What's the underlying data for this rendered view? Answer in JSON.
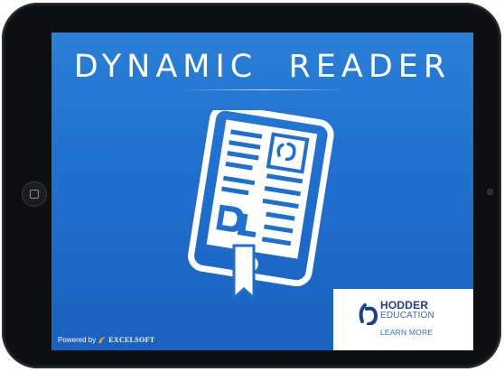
{
  "app": {
    "title": "DYNAMIC  READER"
  },
  "footer": {
    "powered_by": "Powered by",
    "powered_brand": "EXCELSOFT"
  },
  "hodder": {
    "name": "HODDER",
    "subtitle": "EDUCATION",
    "cta": "LEARN MORE"
  },
  "colors": {
    "screen_blue": "#1f6fcf",
    "hodder_blue": "#1d3f86",
    "excelsoft_orange": "#f2a22a"
  },
  "icons": {
    "home_button": "home-square-icon",
    "book": "ebook-reader-icon"
  }
}
